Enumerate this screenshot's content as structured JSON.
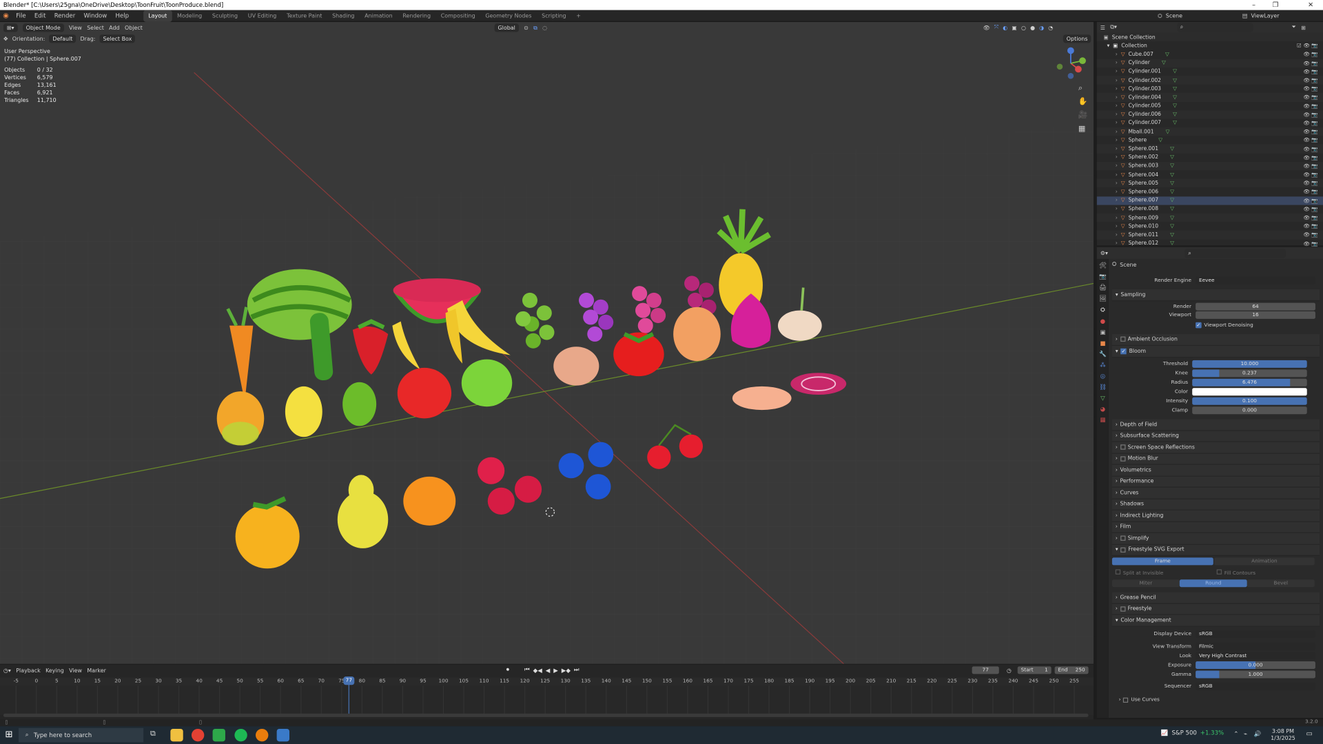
{
  "window": {
    "title": "Blender* [C:\\Users\\25gna\\OneDrive\\Desktop\\ToonFruit\\ToonProduce.blend]"
  },
  "menu": [
    "File",
    "Edit",
    "Render",
    "Window",
    "Help"
  ],
  "workspaces": [
    "Layout",
    "Modeling",
    "Sculpting",
    "UV Editing",
    "Texture Paint",
    "Shading",
    "Animation",
    "Rendering",
    "Compositing",
    "Geometry Nodes",
    "Scripting"
  ],
  "scene": {
    "label": "Scene",
    "view_layer": "ViewLayer"
  },
  "viewport": {
    "mode": "Object Mode",
    "menus": [
      "View",
      "Select",
      "Add",
      "Object"
    ],
    "orientation_label": "Orientation:",
    "orientation_value": "Default",
    "drag_label": "Drag:",
    "drag_value": "Select Box",
    "transform_space": "Global",
    "options": "Options",
    "view_name": "User Perspective",
    "active_info": "(77) Collection | Sphere.007",
    "stats": [
      {
        "k": "Objects",
        "v": "0 / 32"
      },
      {
        "k": "Vertices",
        "v": "6,579"
      },
      {
        "k": "Edges",
        "v": "13,161"
      },
      {
        "k": "Faces",
        "v": "6,921"
      },
      {
        "k": "Triangles",
        "v": "11,710"
      }
    ]
  },
  "outliner": {
    "root": "Scene Collection",
    "collection": "Collection",
    "items": [
      "Cube.007",
      "Cylinder",
      "Cylinder.001",
      "Cylinder.002",
      "Cylinder.003",
      "Cylinder.004",
      "Cylinder.005",
      "Cylinder.006",
      "Cylinder.007",
      "Mball.001",
      "Sphere",
      "Sphere.001",
      "Sphere.002",
      "Sphere.003",
      "Sphere.004",
      "Sphere.005",
      "Sphere.006",
      "Sphere.007",
      "Sphere.008",
      "Sphere.009",
      "Sphere.010",
      "Sphere.011",
      "Sphere.012"
    ]
  },
  "properties": {
    "context": "Scene",
    "render_engine_label": "Render Engine",
    "render_engine": "Eevee",
    "sampling": {
      "title": "Sampling",
      "render_label": "Render",
      "render": "64",
      "viewport_label": "Viewport",
      "viewport": "16",
      "denoise": "Viewport Denoising"
    },
    "ambient_occlusion": "Ambient Occlusion",
    "bloom": {
      "title": "Bloom",
      "threshold_label": "Threshold",
      "threshold": "10.000",
      "knee_label": "Knee",
      "knee": "0.237",
      "knee_level": 0.237,
      "radius_label": "Radius",
      "radius": "6.476",
      "radius_level": 0.85,
      "color_label": "Color",
      "intensity_label": "Intensity",
      "intensity": "0.100",
      "clamp_label": "Clamp",
      "clamp": "0.000"
    },
    "sections": [
      "Depth of Field",
      "Subsurface Scattering",
      "Screen Space Reflections",
      "Motion Blur",
      "Volumetrics",
      "Performance",
      "Curves",
      "Shadows",
      "Indirect Lighting",
      "Film",
      "Simplify",
      "Freestyle SVG Export"
    ],
    "svg_export": {
      "frame": "Frame",
      "animation": "Animation",
      "split_invisible": "Split at Invisible",
      "fill_contours": "Fill Contours",
      "miter": "Miter",
      "round": "Round",
      "bevel": "Bevel"
    },
    "sections2": [
      "Grease Pencil",
      "Freestyle",
      "Color Management"
    ],
    "color_management": {
      "display_label": "Display Device",
      "display": "sRGB",
      "view_label": "View Transform",
      "view": "Filmic",
      "look_label": "Look",
      "look": "Very High Contrast",
      "exposure_label": "Exposure",
      "exposure": "0.000",
      "gamma_label": "Gamma",
      "gamma": "1.000",
      "sequencer_label": "Sequencer",
      "sequencer": "sRGB",
      "use_curves": "Use Curves"
    }
  },
  "timeline": {
    "menus": [
      "Playback",
      "Keying",
      "View",
      "Marker"
    ],
    "current_frame": "77",
    "start_label": "Start",
    "start": "1",
    "end_label": "End",
    "end": "250",
    "ticks": [
      "-5",
      "0",
      "5",
      "10",
      "15",
      "20",
      "25",
      "30",
      "35",
      "40",
      "45",
      "50",
      "55",
      "60",
      "65",
      "70",
      "75",
      "80",
      "85",
      "90",
      "95",
      "100",
      "105",
      "110",
      "115",
      "120",
      "125",
      "130",
      "135",
      "140",
      "145",
      "150",
      "155",
      "160",
      "165",
      "170",
      "175",
      "180",
      "185",
      "190",
      "195",
      "200",
      "205",
      "210",
      "215",
      "220",
      "225",
      "230",
      "235",
      "240",
      "245",
      "250",
      "255"
    ]
  },
  "statusbar": {
    "version": "3.2.0"
  },
  "taskbar": {
    "search": "Type here to search",
    "stock": "S&P 500",
    "change": "+1.33%",
    "time": "3:08 PM",
    "date": "1/3/2025"
  },
  "colors": {
    "accent": "#4772b3",
    "selected_frame": "#4772b3"
  }
}
